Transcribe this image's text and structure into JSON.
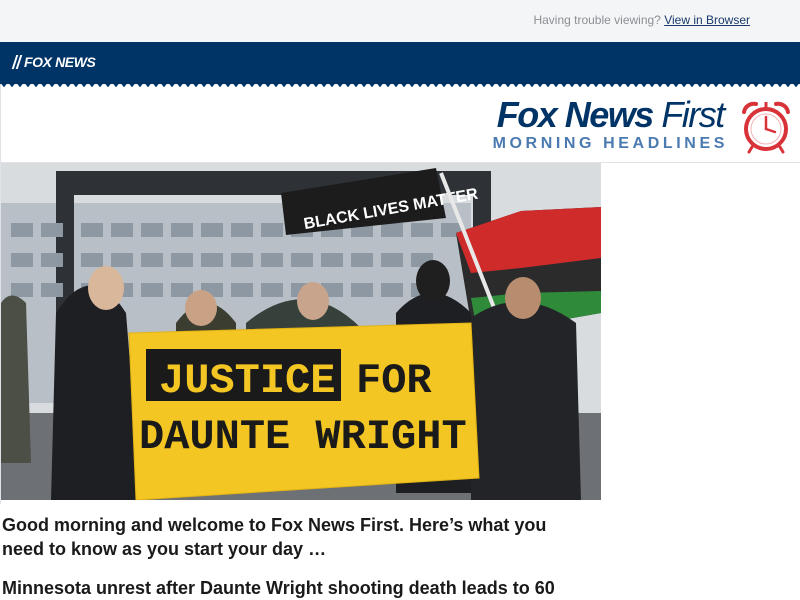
{
  "preheader": {
    "trouble_text": "Having trouble viewing?",
    "view_link": "View in Browser"
  },
  "header": {
    "small_logo": "FOX NEWS",
    "brand_bold": "Fox News",
    "brand_light": "First",
    "brand_sub": "MORNING HEADLINES"
  },
  "hero": {
    "banner_line1_a": "JUSTICE",
    "banner_line1_b": "FOR",
    "banner_line2": "DAUNTE WRIGHT",
    "flag_text": "BLACK LIVES MATTER"
  },
  "body": {
    "intro": "Good morning and welcome to Fox News First. Here’s what you need to know as you start your day …",
    "headline": "Minnesota unrest after Daunte Wright shooting death leads to 60"
  },
  "colors": {
    "nav": "#003366",
    "brand": "#003366",
    "sub": "#4a7ab0",
    "clock": "#d9333a"
  }
}
